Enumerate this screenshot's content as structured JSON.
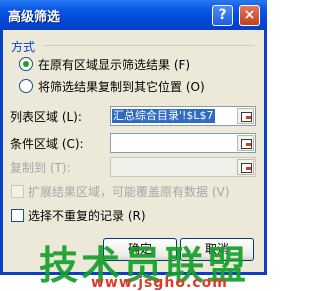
{
  "dialog": {
    "title": "高级筛选",
    "help_glyph": "?",
    "close_glyph": "×"
  },
  "mode_group": {
    "label": "方式",
    "options": [
      {
        "label": "在原有区域显示筛选结果 (F)",
        "selected": true
      },
      {
        "label": "将筛选结果复制到其它位置 (O)",
        "selected": false
      }
    ]
  },
  "fields": {
    "list_range": {
      "label": "列表区域 (L):",
      "value": "汇总综合目录'!$L$7",
      "enabled": true
    },
    "criteria_range": {
      "label": "条件区域 (C):",
      "value": "",
      "enabled": true
    },
    "copy_to": {
      "label": "复制到 (T):",
      "value": "",
      "enabled": false
    }
  },
  "icons": {
    "range_picker": "collapse-dialog-icon"
  },
  "checkboxes": {
    "extend": {
      "label": "扩展结果区域，可能覆盖原有数据 (V)",
      "checked": false,
      "enabled": false
    },
    "unique": {
      "label": "选择不重复的记录 (R)",
      "checked": false,
      "enabled": true
    }
  },
  "buttons": {
    "ok": "确定",
    "cancel": "取消"
  },
  "watermark": {
    "text": "技术员联盟",
    "url": "www.jsgho.com"
  },
  "colors": {
    "titlebar": "#0a58e6",
    "face": "#ece9d8",
    "group_title": "#0046d5",
    "watermark": "#15a02a"
  }
}
